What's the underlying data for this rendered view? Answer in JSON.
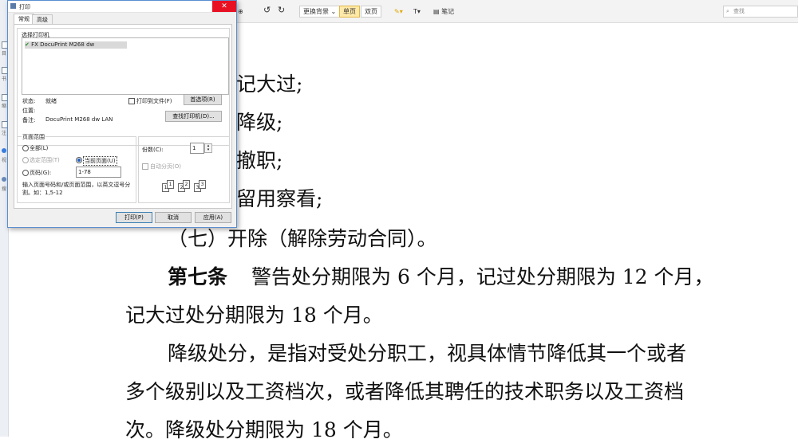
{
  "toolbar": {
    "bg_label": "更换背景",
    "single_label": "单页",
    "double_label": "双页",
    "note_label": "笔记",
    "search_placeholder": "查找"
  },
  "document": {
    "lines": [
      "记大过;",
      "降级;",
      "撤职;",
      "留用察看;",
      "（七）开除（解除劳动合同）。",
      "警告处分期限为 6 个月，记过处分期限为 12 个月，",
      "记大过处分期限为 18 个月。",
      "降级处分，是指对受处分职工，视具体情节降低其一个或者",
      "多个级别以及工资档次，或者降低其聘任的技术职务以及工资档",
      "次。降级处分期限为 18 个月。"
    ],
    "article_label": "第七条"
  },
  "dialog": {
    "title": "打印",
    "close": "✕",
    "tabs": [
      "常规",
      "高级"
    ],
    "select_printer_label": "选择打印机",
    "printer_name": "FX DocuPrint M268 dw",
    "status_label": "状态:",
    "status_value": "就绪",
    "location_label": "位置:",
    "comment_label": "备注:",
    "comment_value": "DocuPrint M268 dw LAN",
    "print_to_file_label": "打印到文件(F)",
    "preferences_button": "首选项(R)",
    "find_printer_button": "查找打印机(D)...",
    "page_range_label": "页面范围",
    "range_all": "全部(L)",
    "range_selection": "选定范围(T)",
    "range_current": "当前页面(U)",
    "range_pages": "页码(G):",
    "pages_value": "1-78",
    "hint_line1": "输入页面号码和/或页面范围，以英文逗号分",
    "hint_line2": "割。如：1,5-12",
    "copies_label": "份数(C):",
    "copies_value": "1",
    "collate_label": "自动分页(O)",
    "print_button": "打印(P)",
    "cancel_button": "取消",
    "apply_button": "应用(A)"
  },
  "sidebar": {
    "labels": [
      "目",
      "书",
      "缩",
      "注",
      "视",
      "搜"
    ]
  }
}
